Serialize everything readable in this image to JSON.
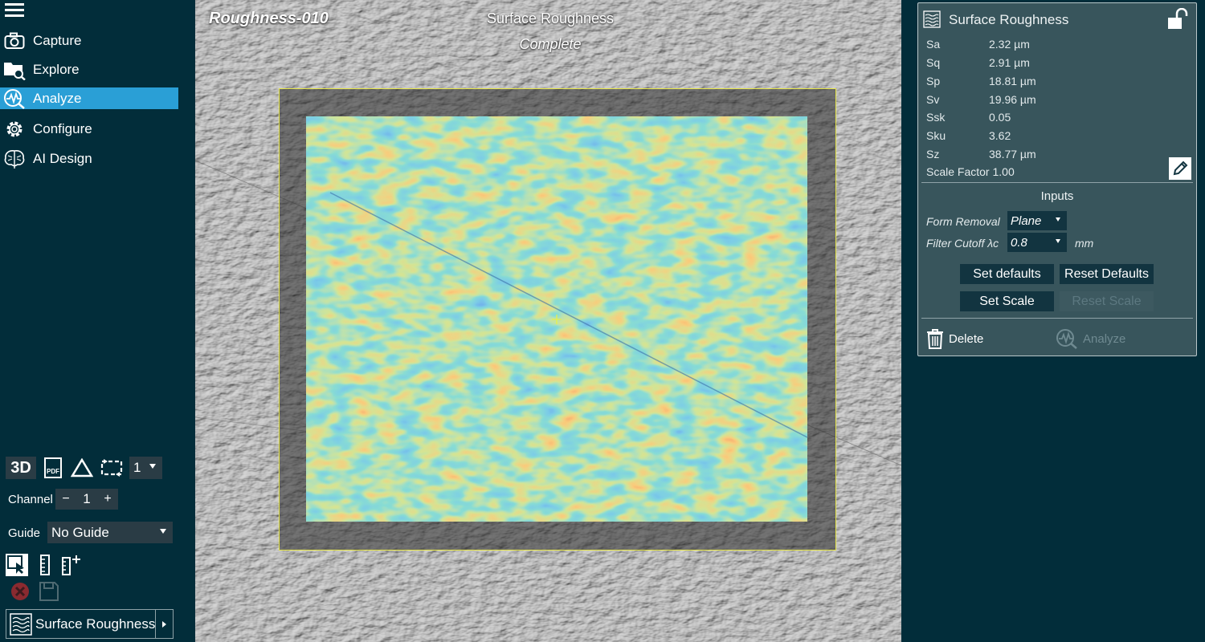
{
  "sidebar": {
    "nav": [
      {
        "label": "Capture",
        "icon": "camera-icon"
      },
      {
        "label": "Explore",
        "icon": "folder-search-icon"
      },
      {
        "label": "Analyze",
        "icon": "analyze-wave-icon"
      },
      {
        "label": "Configure",
        "icon": "gear-icon"
      },
      {
        "label": "AI Design",
        "icon": "brain-icon"
      }
    ],
    "toolbar": {
      "btn_3d": "3D",
      "pdf": "PDF",
      "layer_value": "1"
    },
    "channel": {
      "label": "Channel",
      "minus": "−",
      "value": "1",
      "plus": "+"
    },
    "guide": {
      "label": "Guide",
      "value": "No Guide"
    },
    "tool_selector": {
      "label": "Surface Roughness"
    }
  },
  "viewer": {
    "name": "Roughness-010",
    "tool_title": "Surface Roughness",
    "status": "Complete"
  },
  "panel": {
    "title": "Surface Roughness",
    "results": [
      {
        "name": "Sa",
        "value": "2.32 µm"
      },
      {
        "name": "Sq",
        "value": "2.91 µm"
      },
      {
        "name": "Sp",
        "value": "18.81 µm"
      },
      {
        "name": "Sv",
        "value": "19.96 µm"
      },
      {
        "name": "Ssk",
        "value": "0.05"
      },
      {
        "name": "Sku",
        "value": "3.62"
      },
      {
        "name": "Sz",
        "value": "38.77 µm"
      }
    ],
    "scale_factor": "Scale Factor 1.00",
    "inputs_title": "Inputs",
    "form_removal": {
      "label": "Form Removal",
      "value": "Plane"
    },
    "filter_cutoff": {
      "label": "Filter Cutoff λc",
      "value": "0.8",
      "unit": "mm"
    },
    "buttons": {
      "set_defaults": "Set defaults",
      "reset_defaults": "Reset Defaults",
      "set_scale": "Set Scale",
      "reset_scale": "Reset Scale"
    },
    "delete": "Delete",
    "analyze": "Analyze"
  },
  "colors": {
    "sidebar_bg": "#022d3a",
    "accent": "#2a9fd6",
    "panel_bg": "#38555c",
    "roi_border": "#e6e64a"
  }
}
